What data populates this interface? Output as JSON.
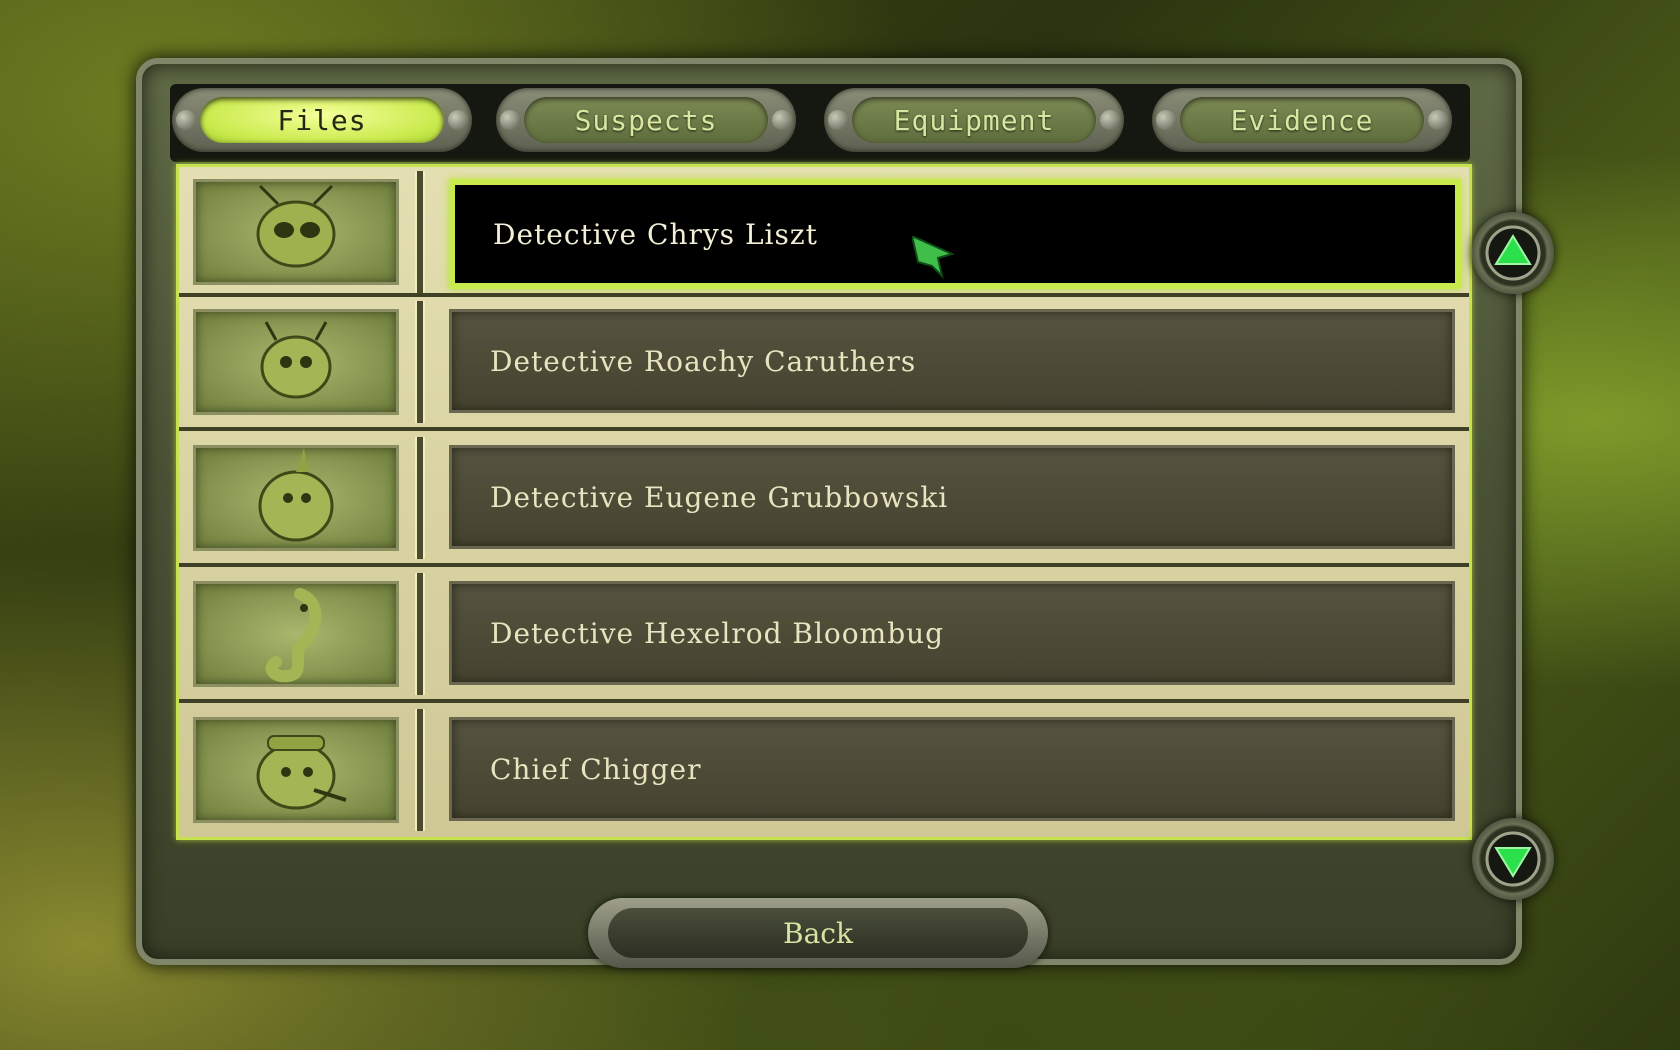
{
  "tabs": [
    {
      "label": "Files",
      "active": true
    },
    {
      "label": "Suspects",
      "active": false
    },
    {
      "label": "Equipment",
      "active": false
    },
    {
      "label": "Evidence",
      "active": false
    }
  ],
  "files": [
    {
      "name": "Detective Chrys Liszt",
      "portrait_icon": "bug-portrait-chrys-liszt",
      "selected": true
    },
    {
      "name": "Detective Roachy Caruthers",
      "portrait_icon": "bug-portrait-roachy-caruthers",
      "selected": false
    },
    {
      "name": "Detective Eugene Grubbowski",
      "portrait_icon": "bug-portrait-eugene-grubbowski",
      "selected": false
    },
    {
      "name": "Detective Hexelrod Bloombug",
      "portrait_icon": "bug-portrait-hexelrod-bloombug",
      "selected": false
    },
    {
      "name": "Chief Chigger",
      "portrait_icon": "bug-portrait-chief-chigger",
      "selected": false
    }
  ],
  "scroll": {
    "up_icon": "arrow-up-icon",
    "down_icon": "arrow-down-icon"
  },
  "back_label": "Back",
  "colors": {
    "accent": "#c9ea4c",
    "panel": "#4a5236",
    "row_bg": "#45432f"
  }
}
